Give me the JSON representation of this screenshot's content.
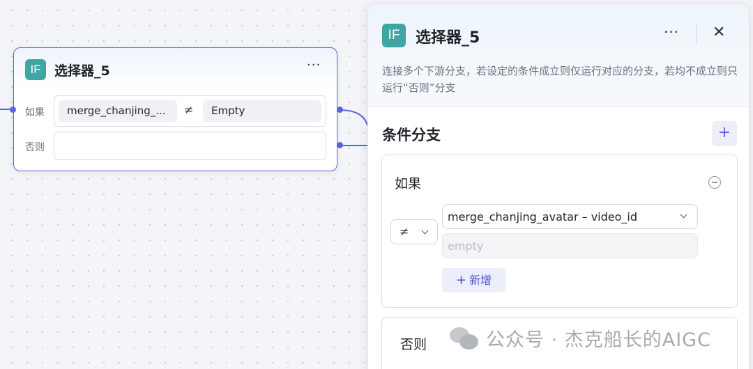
{
  "node": {
    "badge": "IF",
    "title": "选择器_5",
    "more": "···",
    "if_label": "如果",
    "else_label": "否则",
    "condition": {
      "variable": "merge_chanjing_...",
      "operator": "≠",
      "value": "Empty"
    }
  },
  "panel": {
    "badge": "IF",
    "title": "选择器_5",
    "more": "···",
    "close": "✕",
    "description": "连接多个下游分支，若设定的条件成立则仅运行对应的分支，若均不成立则只运行“否则”分支",
    "section_title": "条件分支",
    "add_branch": "+",
    "if_card": {
      "label": "如果",
      "operator": "≠",
      "variable": "merge_chanjing_avatar – video_id",
      "value_placeholder": "empty",
      "add_condition_plus": "+",
      "add_condition_label": "新增"
    },
    "else_card": {
      "label": "否则"
    }
  },
  "watermark": {
    "text": "公众号 · 杰克船长的AIGC"
  },
  "colors": {
    "accent": "#5a61e8",
    "badge": "#3fa7a3",
    "canvas": "#f4f5f8"
  }
}
